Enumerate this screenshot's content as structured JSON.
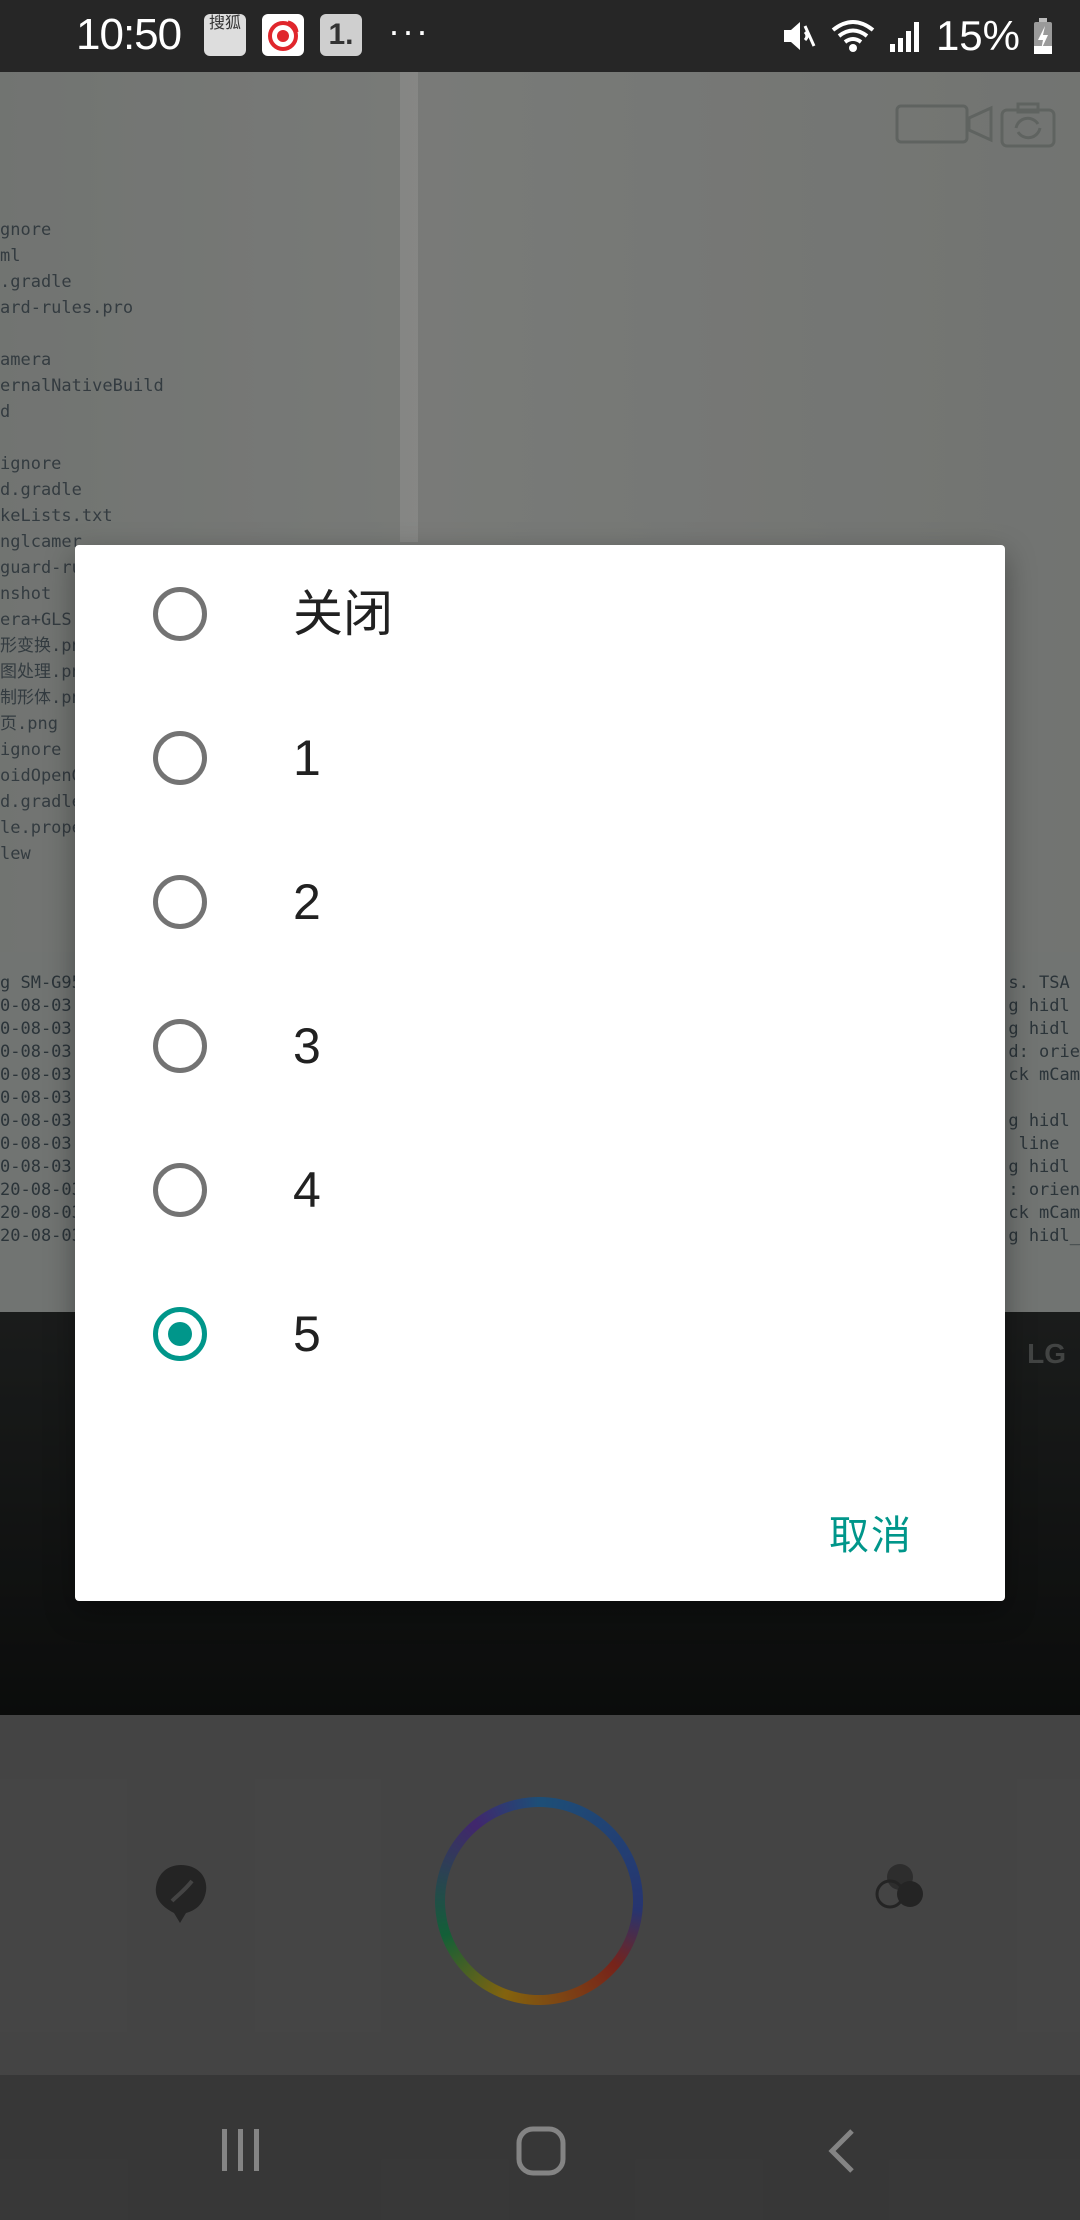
{
  "status_bar": {
    "time": "10:50",
    "notif_sohu_label": "搜狐",
    "notif_one_label": "1.",
    "more": "···",
    "battery": "15%"
  },
  "dialog": {
    "options": [
      {
        "label": "关闭",
        "checked": false
      },
      {
        "label": "1",
        "checked": false
      },
      {
        "label": "2",
        "checked": false
      },
      {
        "label": "3",
        "checked": false
      },
      {
        "label": "4",
        "checked": false
      },
      {
        "label": "5",
        "checked": true
      }
    ],
    "cancel_label": "取消"
  },
  "camera_preview": {
    "code_text": "gnore\nml\n.gradle\nard-rules.pro\n\namera\nernalNativeBuild\nd\n\nignore\nd.gradle\nkeLists.txt\nnglcamer\nguard-ru\nnshot\nera+GLS\n形变换.png\n图处理.png\n制形体.png\n页.png\nignore\noidOpenG\nd.gradle\nle.prope\nlew",
    "log_left": "g SM-G95\n0-08-03\n0-08-03\n0-08-03\n0-08-03\n0-08-03\n0-08-03\n0-08-03\n0-08-03\n20-08-03\n20-08-03\n20-08-03",
    "log_right": "s. TSA\ng hidl\ng hidl\nd: orie\nck mCam\n\ng hidl\n line\ng hidl\n: orien\nck mCam\ng hidl_",
    "brand": "LG"
  },
  "colors": {
    "accent": "#00968a",
    "radio_off": "#737373",
    "text": "#212121",
    "status_bar": "#262626"
  },
  "icons": {
    "nav": [
      "recents-icon",
      "home-icon",
      "back-icon"
    ],
    "controls": [
      "beauty-icon",
      "shutter-ring",
      "filter-icon"
    ],
    "camera_top": [
      "video-icon",
      "switch-camera-icon"
    ]
  }
}
